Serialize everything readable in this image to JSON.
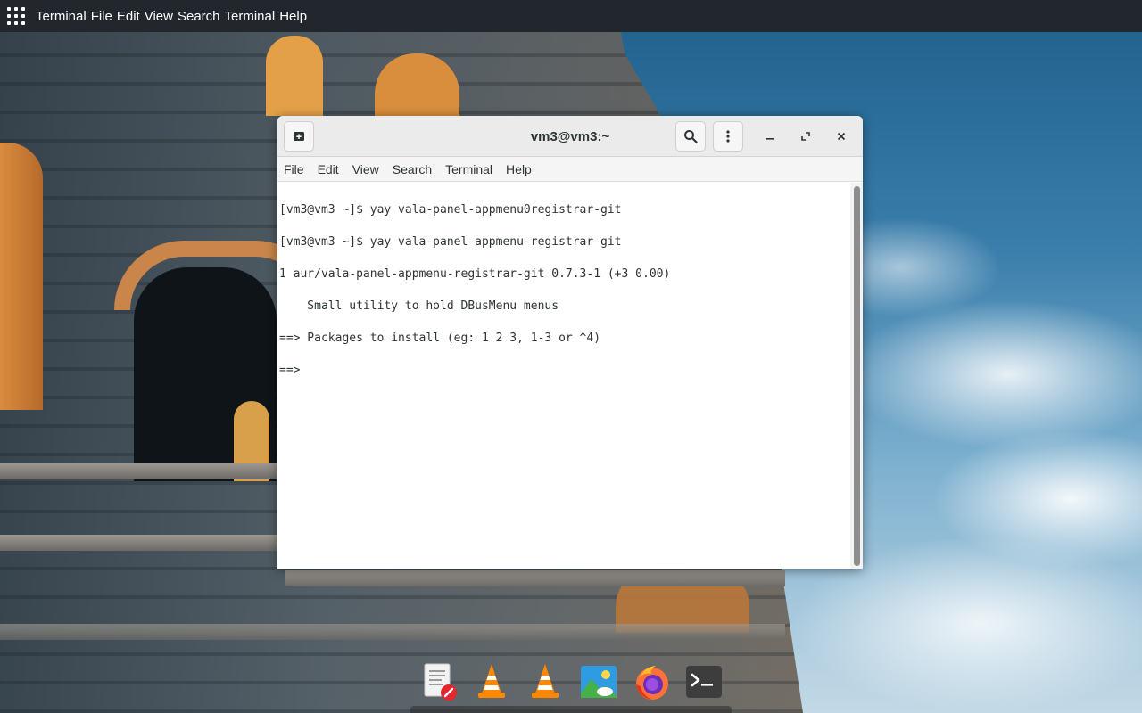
{
  "topbar": {
    "app_name": "Terminal",
    "menu": [
      "File",
      "Edit",
      "View",
      "Search",
      "Terminal",
      "Help"
    ]
  },
  "window": {
    "title": "vm3@vm3:~",
    "menu": [
      "File",
      "Edit",
      "View",
      "Search",
      "Terminal",
      "Help"
    ],
    "terminal_lines": [
      "[vm3@vm3 ~]$ yay vala-panel-appmenu0registrar-git",
      "[vm3@vm3 ~]$ yay vala-panel-appmenu-registrar-git",
      "1 aur/vala-panel-appmenu-registrar-git 0.7.3-1 (+3 0.00)",
      "    Small utility to hold DBusMenu menus",
      "==> Packages to install (eg: 1 2 3, 1-3 or ^4)",
      "==> "
    ]
  },
  "dock": {
    "items": [
      {
        "icon": "text-editor-icon"
      },
      {
        "icon": "vlc-icon"
      },
      {
        "icon": "vlc-icon"
      },
      {
        "icon": "image-viewer-icon"
      },
      {
        "icon": "firefox-icon"
      },
      {
        "icon": "terminal-icon"
      }
    ]
  },
  "colors": {
    "topbar_bg": "#22272e",
    "headerbar_bg": "#ebebeb",
    "terminal_bg": "#ffffff",
    "terminal_fg": "#2e3436"
  }
}
